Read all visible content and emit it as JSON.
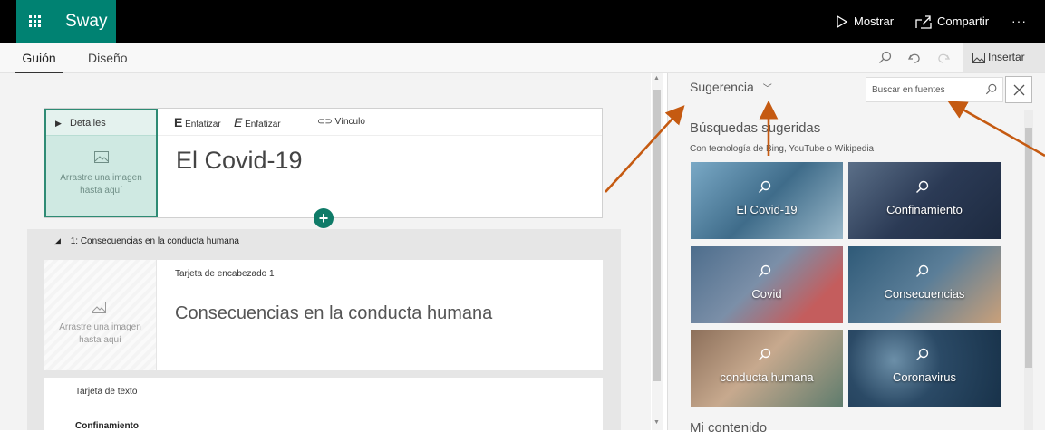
{
  "app": {
    "name": "Sway",
    "mostrar": "Mostrar",
    "compartir": "Compartir",
    "more": "···",
    "brand_color": "#008272"
  },
  "tabs": {
    "guion": "Guión",
    "diseno": "Diseño",
    "insertar": "Insertar"
  },
  "title_card": {
    "detalles": "Detalles",
    "enfatizar1": "Enfatizar",
    "enfatizar2": "Enfatizar",
    "vinculo": "Vínculo",
    "title": "El Covid-19",
    "drop1": "Arrastre una imagen",
    "drop2": "hasta aquí"
  },
  "section": {
    "header": "1: Consecuencias en la conducta humana",
    "card_label": "Tarjeta de encabezado 1",
    "card_title": "Consecuencias en la conducta humana",
    "drop1": "Arrastre una imagen",
    "drop2": "hasta aquí",
    "text_card_label": "Tarjeta de texto",
    "text_card_content": "Confinamiento"
  },
  "panel": {
    "dropdown": "Sugerencia",
    "search_placeholder": "Buscar en fuentes",
    "heading": "Búsquedas sugeridas",
    "sub": "Con tecnología de Bing, YouTube o Wikipedia",
    "tiles": [
      "El Covid-19",
      "Confinamiento",
      "Covid",
      "Consecuencias",
      "conducta humana",
      "Coronavirus"
    ],
    "mi_contenido": "Mi contenido"
  },
  "annotation_color": "#c55a11"
}
